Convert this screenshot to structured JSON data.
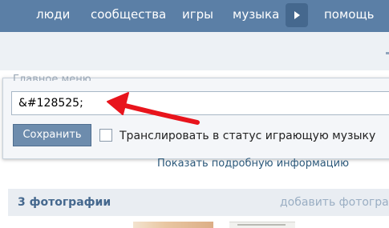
{
  "nav": {
    "items": [
      "люди",
      "сообщества",
      "игры",
      "музыка",
      "помощь"
    ]
  },
  "status_panel": {
    "title": "Главное меню",
    "input_value": "&#128525;",
    "save_label": "Сохранить",
    "broadcast_label": "Транслировать в статус играющую музыку",
    "broadcast_checked": false
  },
  "more_info_link": "Показать подробную информацию",
  "photos": {
    "count_label": "3 фотографии",
    "add_label": "добавить фотогра"
  },
  "annotation": {
    "arrow_color": "#e8141c"
  },
  "colors": {
    "nav_bg": "#5b7fa6",
    "link": "#2b587a",
    "button_bg": "#6d8cad"
  }
}
